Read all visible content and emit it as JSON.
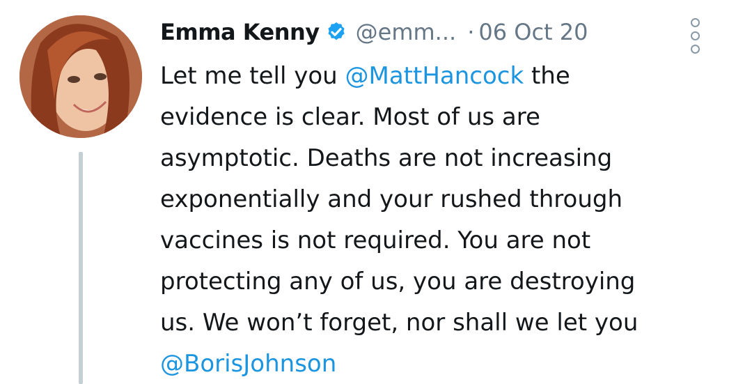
{
  "author": {
    "name": "Emma Kenny",
    "handle": "@emm...",
    "verified_icon": "verified-badge-icon",
    "separator": "·",
    "date": "06 Oct 20"
  },
  "tweet": {
    "lines": [
      {
        "before": "Let me tell you ",
        "mention": "@MattHancock",
        "after": " the"
      },
      {
        "text": "evidence is clear. Most of us are"
      },
      {
        "text": "asymptotic. Deaths are not increasing"
      },
      {
        "text": "exponentially and your rushed through"
      },
      {
        "text": "vaccines is not required. You are not"
      },
      {
        "text": "protecting any of us, you are destroying"
      },
      {
        "text": "us. We won’t forget, nor shall we let you"
      },
      {
        "mention": "@BorisJohnson"
      }
    ]
  },
  "colors": {
    "mention": "#1b95e0",
    "muted": "#657786",
    "verified": "#1da1f2",
    "thread_line": "#c4cfd6"
  },
  "icons": {
    "more": "more-options-icon",
    "avatar": "profile-avatar"
  }
}
